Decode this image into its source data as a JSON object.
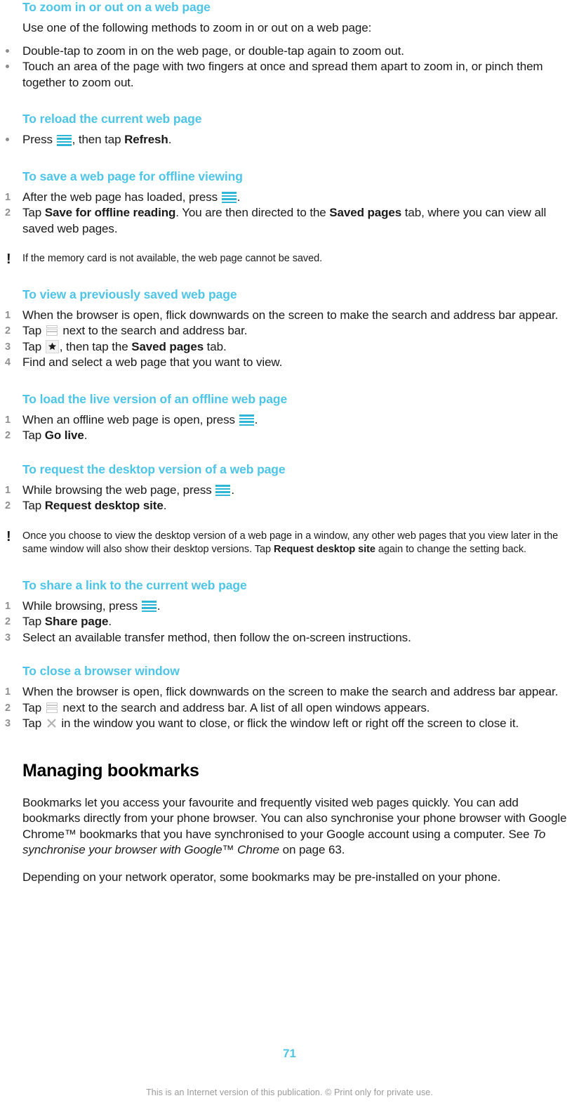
{
  "document": {
    "page_number": "71",
    "footer_note": "This is an Internet version of this publication. © Print only for private use.",
    "accent_color": "#4DC5E8",
    "icon_color": "#2FB6D6",
    "marker_color": "#8F8F8F"
  },
  "icons": {
    "menu": "menu-key-icon",
    "windows": "browser-windows-icon",
    "star": "bookmark-star-icon",
    "close": "close-window-icon",
    "note": "note-exclamation-icon"
  },
  "sections": {
    "zoom": {
      "heading": "To zoom in or out on a web page",
      "intro": "Use one of the following methods to zoom in or out on a web page:",
      "bullets": [
        "Double-tap to zoom in on the web page, or double-tap again to zoom out.",
        "Touch an area of the page with two fingers at once and spread them apart to zoom in, or pinch them together to zoom out."
      ]
    },
    "reload": {
      "heading": "To reload the current web page",
      "bullet_pre": "Press ",
      "bullet_mid": ", then tap ",
      "bullet_bold": "Refresh",
      "bullet_end": "."
    },
    "save_offline": {
      "heading": "To save a web page for offline viewing",
      "step1_pre": "After the web page has loaded, press ",
      "step1_end": ".",
      "step2_pre": "Tap ",
      "step2_bold1": "Save for offline reading",
      "step2_mid": ". You are then directed to the ",
      "step2_bold2": "Saved pages",
      "step2_end": " tab, where you can view all saved web pages.",
      "note": "If the memory card is not available, the web page cannot be saved."
    },
    "view_saved": {
      "heading": "To view a previously saved web page",
      "step1": "When the browser is open, flick downwards on the screen to make the search and address bar appear.",
      "step2_pre": "Tap ",
      "step2_end": " next to the search and address bar.",
      "step3_pre": "Tap ",
      "step3_mid": ", then tap the ",
      "step3_bold": "Saved pages",
      "step3_end": " tab.",
      "step4": "Find and select a web page that you want to view."
    },
    "load_live": {
      "heading": "To load the live version of an offline web page",
      "step1_pre": "When an offline web page is open, press ",
      "step1_end": ".",
      "step2_pre": "Tap ",
      "step2_bold": "Go live",
      "step2_end": "."
    },
    "desktop_version": {
      "heading": "To request the desktop version of a web page",
      "step1_pre": "While browsing the web page, press ",
      "step1_end": ".",
      "step2_pre": "Tap ",
      "step2_bold": "Request desktop site",
      "step2_end": ".",
      "note_pre": "Once you choose to view the desktop version of a web page in a window, any other web pages that you view later in the same window will also show their desktop versions. Tap ",
      "note_bold": "Request desktop site",
      "note_end": " again to change the setting back."
    },
    "share_link": {
      "heading": "To share a link to the current web page",
      "step1_pre": "While browsing, press ",
      "step1_end": ".",
      "step2_pre": "Tap ",
      "step2_bold": "Share page",
      "step2_end": ".",
      "step3": "Select an available transfer method, then follow the on-screen instructions."
    },
    "close_window": {
      "heading": "To close a browser window",
      "step1": "When the browser is open, flick downwards on the screen to make the search and address bar appear.",
      "step2_pre": "Tap ",
      "step2_end": " next to the search and address bar. A list of all open windows appears.",
      "step3_pre": "Tap ",
      "step3_end": " in the window you want to close, or flick the window left or right off the screen to close it."
    },
    "managing_bookmarks": {
      "heading": "Managing bookmarks",
      "para1_pre": "Bookmarks let you access your favourite and frequently visited web pages quickly. You can add bookmarks directly from your phone browser. You can also synchronise your phone browser with Google Chrome™ bookmarks that you have synchronised to your Google account using a computer. See ",
      "para1_italic": "To synchronise your browser with Google™ Chrome",
      "para1_end": " on page 63.",
      "para2": "Depending on your network operator, some bookmarks may be pre-installed on your phone."
    }
  }
}
